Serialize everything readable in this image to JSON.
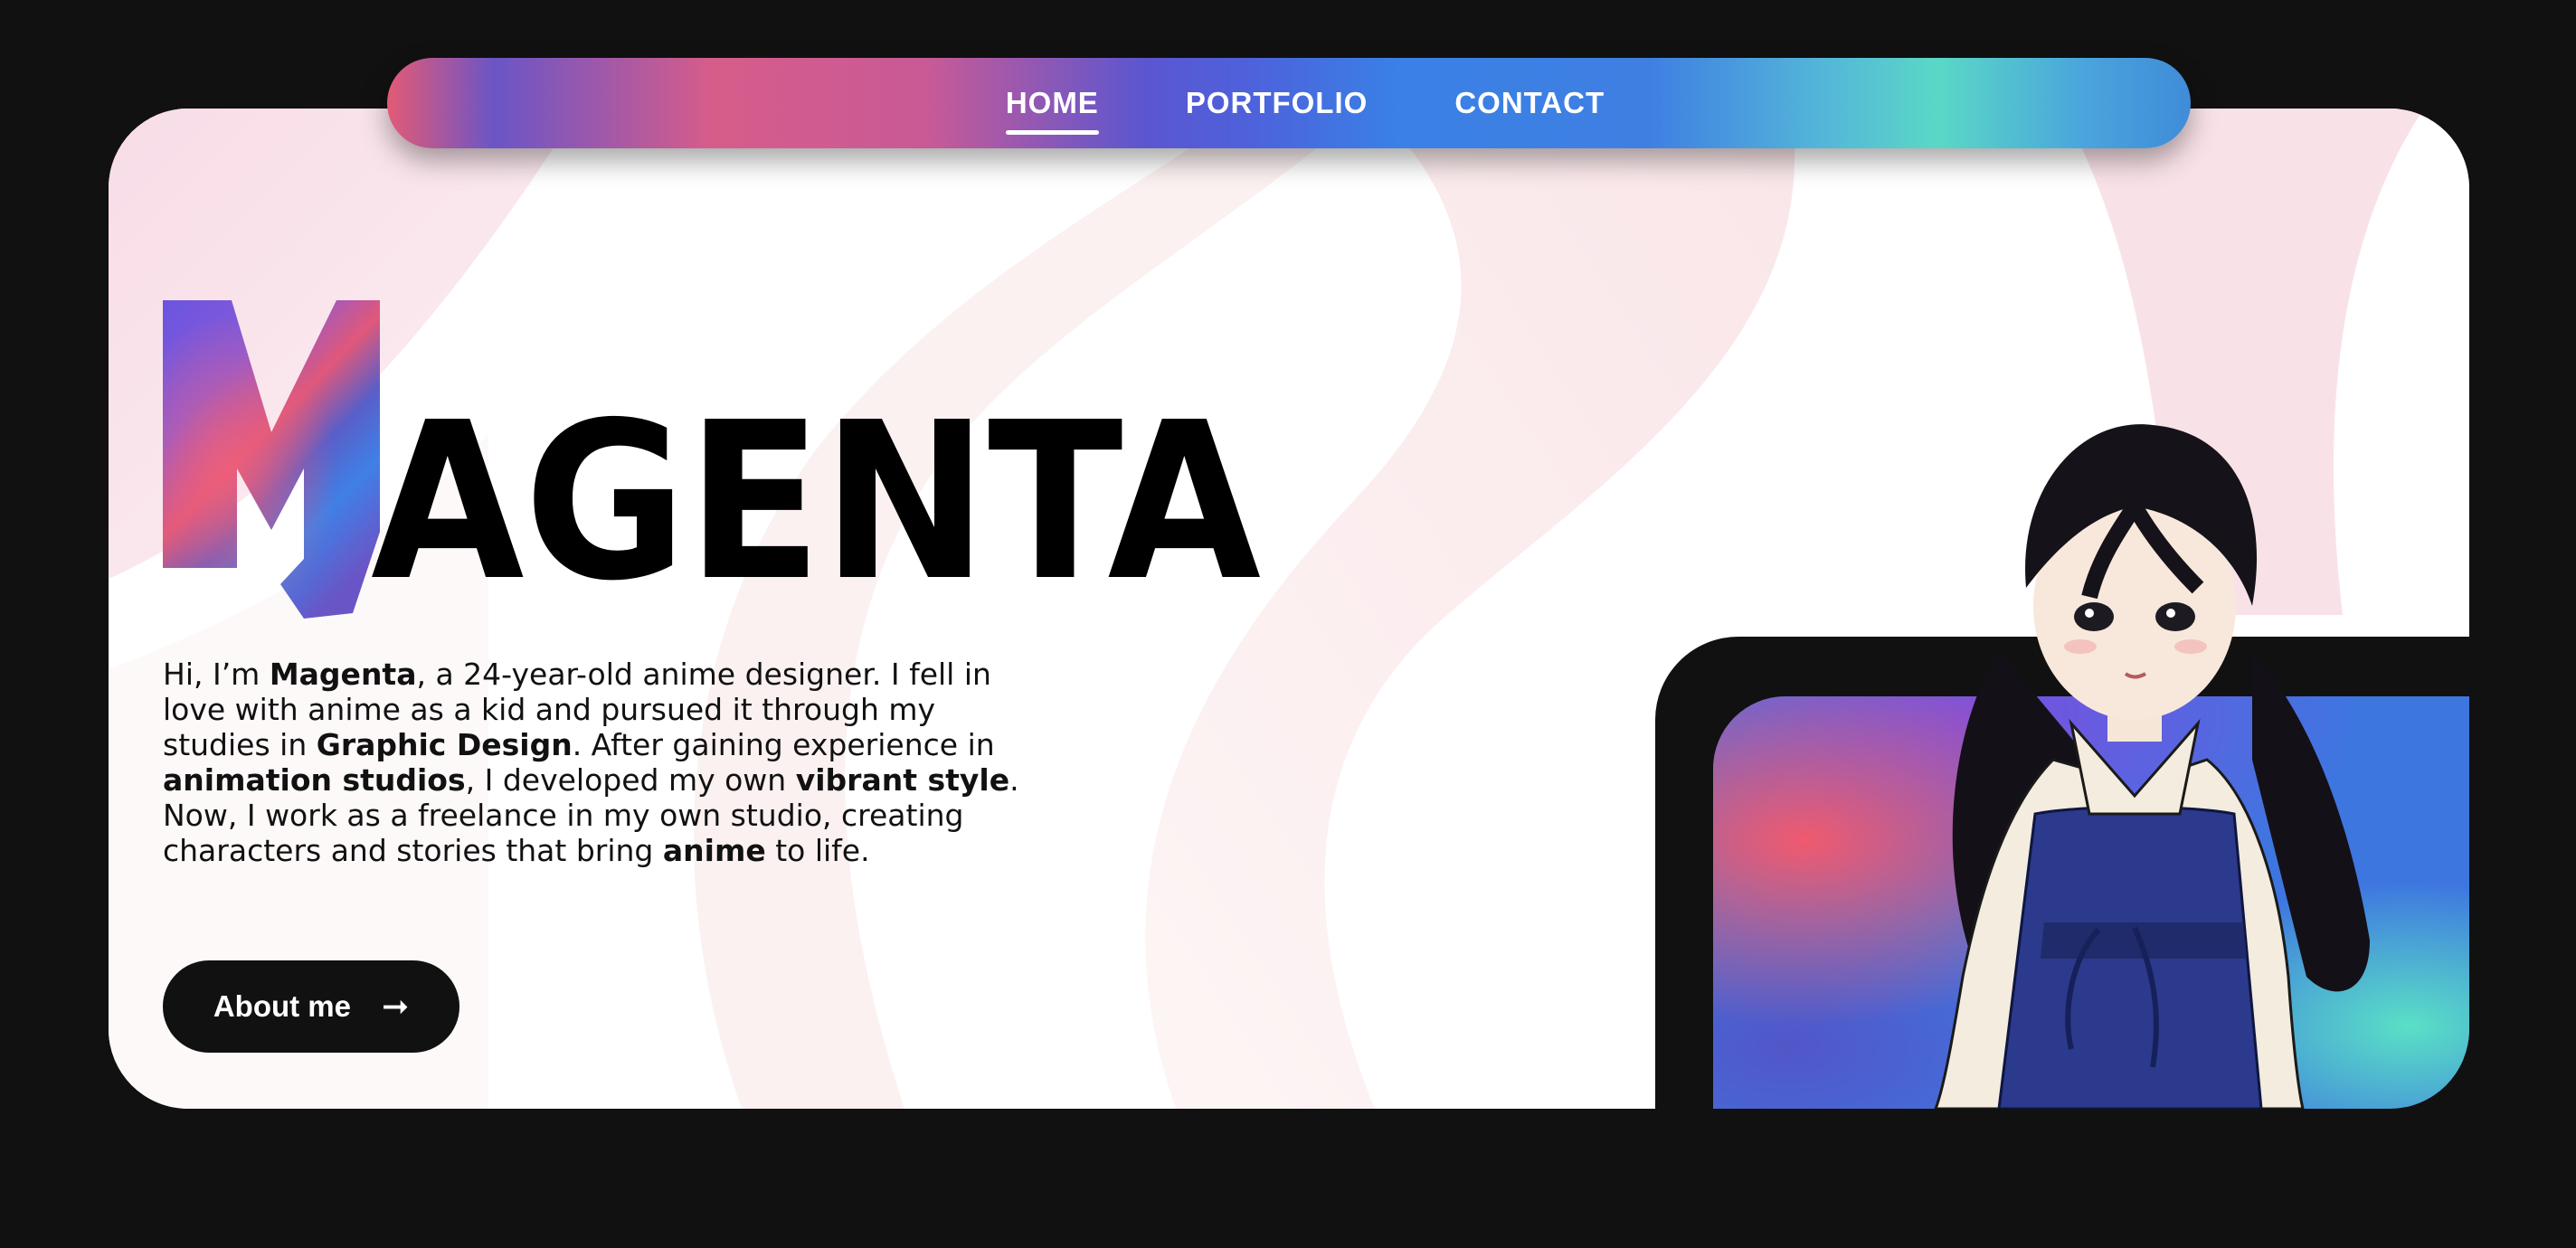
{
  "nav": {
    "items": [
      {
        "label": "HOME",
        "active": true
      },
      {
        "label": "PORTFOLIO",
        "active": false
      },
      {
        "label": "CONTACT",
        "active": false
      }
    ]
  },
  "hero": {
    "title_first_letter": "M",
    "title_rest": "AGENTA",
    "intro": [
      {
        "text": "Hi, I’m ",
        "bold": false
      },
      {
        "text": "Magenta",
        "bold": true
      },
      {
        "text": ", a 24-year-old anime designer. I fell in love with anime as a kid and pursued it through my studies in ",
        "bold": false
      },
      {
        "text": "Graphic Design",
        "bold": true
      },
      {
        "text": ". After gaining experience in ",
        "bold": false
      },
      {
        "text": "animation studios",
        "bold": true
      },
      {
        "text": ", I developed my own ",
        "bold": false
      },
      {
        "text": "vibrant style",
        "bold": true
      },
      {
        "text": ". Now, I work as a freelance in my own studio, creating characters and stories that bring ",
        "bold": false
      },
      {
        "text": "anime",
        "bold": true
      },
      {
        "text": " to life.",
        "bold": false
      }
    ],
    "about_button_label": "About me",
    "about_button_icon": "arrow-right-icon"
  },
  "colors": {
    "page_background": "#111111",
    "card_background": "#ffffff",
    "accent_pink": "#e35a76",
    "accent_purple": "#6a55c6",
    "accent_blue": "#3f7fe2",
    "accent_teal": "#5ad8c6",
    "button_background": "#111111"
  }
}
